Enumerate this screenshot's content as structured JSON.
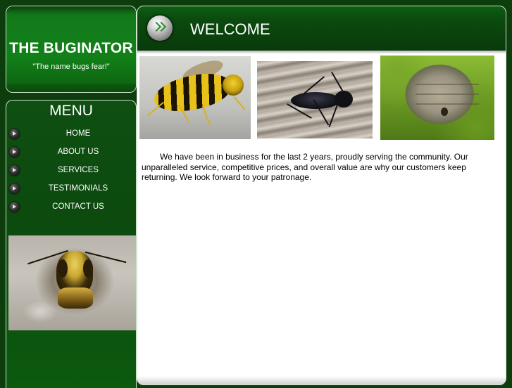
{
  "site": {
    "title": "THE BUGINATOR",
    "tagline": "\"The name bugs fear!\""
  },
  "menu": {
    "title": "MENU",
    "items": [
      {
        "label": "HOME"
      },
      {
        "label": "ABOUT US"
      },
      {
        "label": "SERVICES"
      },
      {
        "label": "TESTIMONIALS"
      },
      {
        "label": "CONTACT US"
      }
    ]
  },
  "main": {
    "heading": "WELCOME",
    "photos": [
      "yellowjacket-photo",
      "carpenter-ant-photo",
      "hornet-nest-photo"
    ],
    "intro": "We have been in business for the last 2 years, proudly serving the community.  Our unparalleled service, competitive prices, and overall value are why our customers keep returning.  We look forward to your patronage."
  },
  "colors": {
    "background": "#0d3d0d",
    "panel_green": "#128018",
    "content_bg": "#ffffff",
    "text_light": "#ffffff"
  }
}
